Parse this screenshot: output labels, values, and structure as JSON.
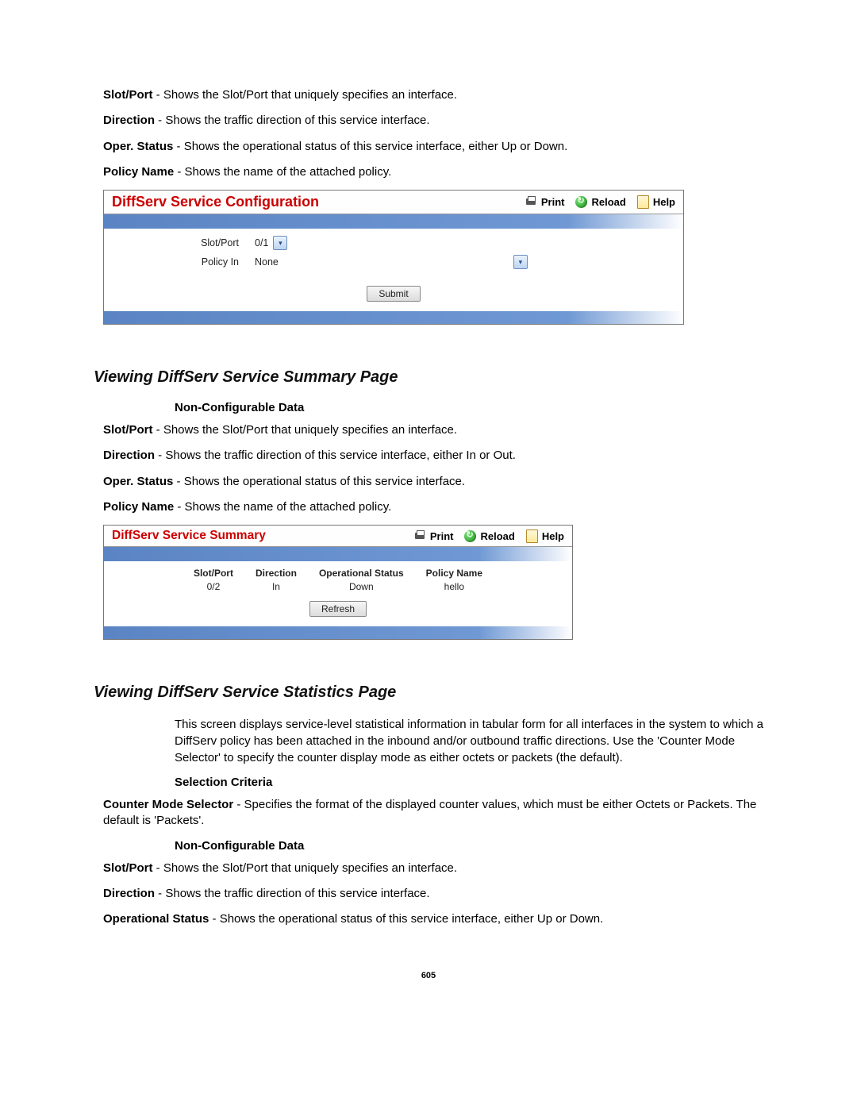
{
  "intro_defs": [
    {
      "term": "Slot/Port",
      "desc": " - Shows the Slot/Port that uniquely specifies an interface."
    },
    {
      "term": "Direction",
      "desc": " - Shows the traffic direction of this service interface."
    },
    {
      "term": "Oper. Status",
      "desc": " - Shows the operational status of this service interface, either Up or Down."
    },
    {
      "term": "Policy Name",
      "desc": " - Shows the name of the attached policy."
    }
  ],
  "panel1": {
    "title": "DiffServ Service Configuration",
    "print_label": "Print",
    "reload_label": "Reload",
    "help_label": "Help",
    "row1_label": "Slot/Port",
    "row1_value": "0/1",
    "row2_label": "Policy In",
    "row2_value": "None",
    "submit_label": "Submit"
  },
  "section2": {
    "heading": "Viewing DiffServ Service Summary Page",
    "subhead": "Non-Configurable Data",
    "defs": [
      {
        "term": "Slot/Port",
        "desc": " - Shows the Slot/Port that uniquely specifies an interface."
      },
      {
        "term": "Direction",
        "desc": " - Shows the traffic direction of this service interface, either In or Out."
      },
      {
        "term": "Oper. Status",
        "desc": " - Shows the operational status of this service interface."
      },
      {
        "term": "Policy Name",
        "desc": " - Shows the name of the attached policy."
      }
    ]
  },
  "panel2": {
    "title": "DiffServ Service Summary",
    "print_label": "Print",
    "reload_label": "Reload",
    "help_label": "Help",
    "columns": [
      "Slot/Port",
      "Direction",
      "Operational Status",
      "Policy Name"
    ],
    "row": [
      "0/2",
      "In",
      "Down",
      "hello"
    ],
    "refresh_label": "Refresh"
  },
  "section3": {
    "heading": "Viewing DiffServ Service Statistics Page",
    "intro": "This screen displays service-level statistical information in tabular form for all interfaces in the system to which a DiffServ policy has been attached in the inbound and/or outbound traffic directions. Use the 'Counter Mode Selector' to specify the counter display mode as either octets or packets (the default).",
    "sel_head": "Selection Criteria",
    "sel_def": {
      "term": "Counter Mode Selector",
      "desc": " - Specifies the format of the displayed counter values, which must be either Octets or Packets. The default is 'Packets'."
    },
    "nc_head": "Non-Configurable Data",
    "defs": [
      {
        "term": "Slot/Port",
        "desc": " - Shows the Slot/Port that uniquely specifies an interface."
      },
      {
        "term": "Direction",
        "desc": " - Shows the traffic direction of this service interface."
      },
      {
        "term": "Operational Status",
        "desc": " - Shows the operational status of this service interface, either Up or Down."
      }
    ]
  },
  "page_number": "605"
}
